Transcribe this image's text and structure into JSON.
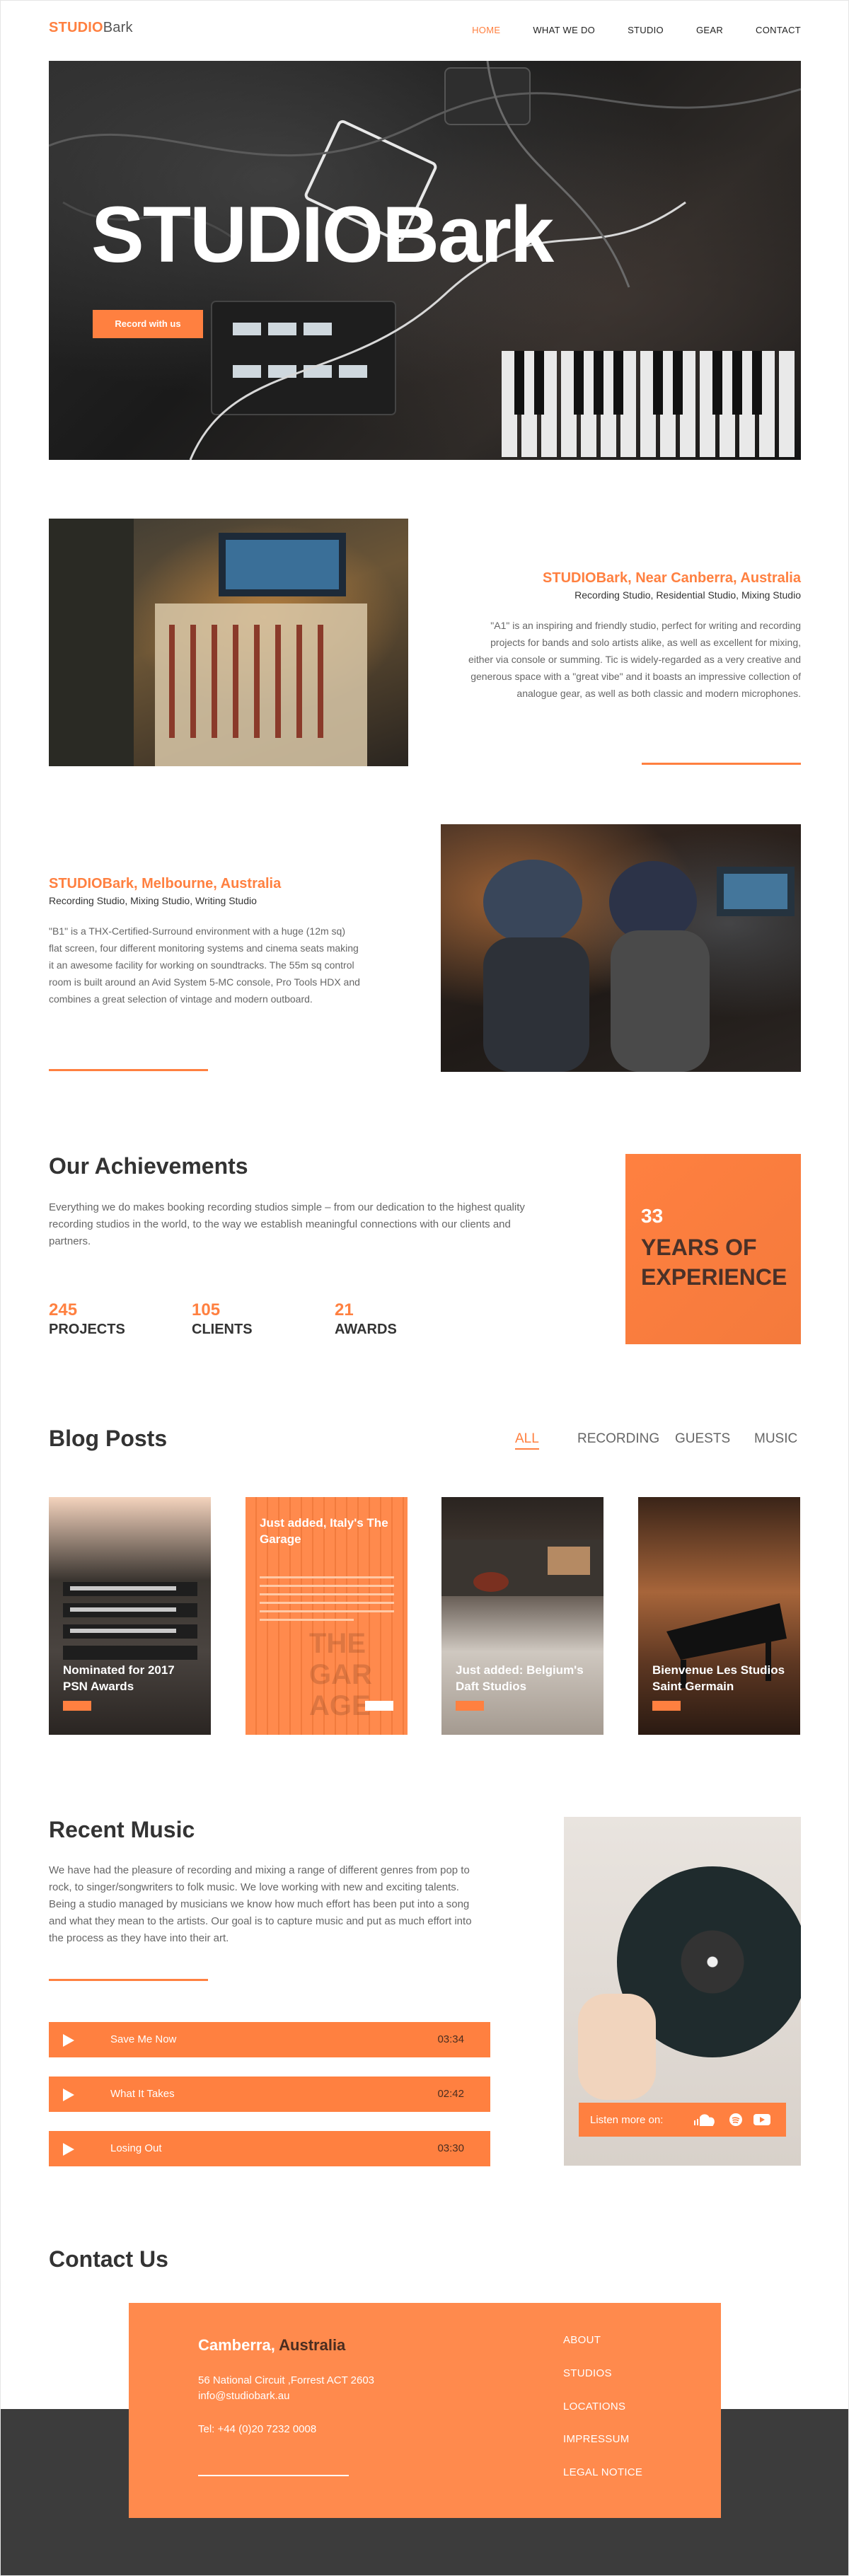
{
  "header": {
    "logo_part1": "STUDIO",
    "logo_part2": "Bark",
    "nav": [
      "HOME",
      "WHAT WE DO",
      "STUDIO",
      "GEAR",
      "CONTACT"
    ]
  },
  "hero": {
    "title": "STUDIOBark",
    "cta": "Record with us"
  },
  "studios": [
    {
      "title": "STUDIOBark, Near Canberra, Australia",
      "subtitle": "Recording Studio, Residential Studio, Mixing Studio",
      "text": "\"A1\" is an inspiring and friendly studio, perfect for writing and recording projects for bands and solo artists alike, as well as excellent for mixing, either via console or summing. Tic is widely-regarded as a very creative and generous space with a \"great vibe\" and it boasts an impressive collection of analogue gear, as well as both classic and modern microphones."
    },
    {
      "title": "STUDIOBark, Melbourne, Australia",
      "subtitle": "Recording Studio, Mixing Studio, Writing Studio",
      "text": "\"B1\" is a THX-Certified-Surround environment with a huge (12m sq) flat screen, four different monitoring systems and cinema seats making it an awesome facility for working on soundtracks. The 55m sq control room is built around an Avid System 5-MC console, Pro Tools HDX and combines a great selection of vintage and modern outboard."
    }
  ],
  "achievements": {
    "heading": "Our Achievements",
    "text": "Everything we do makes booking recording studios simple – from our dedication to the highest quality recording studios in the world, to the way we establish meaningful connections with our clients and partners.",
    "stats": [
      {
        "num": "245",
        "label": "PROJECTS"
      },
      {
        "num": "105",
        "label": "CLIENTS"
      },
      {
        "num": "21",
        "label": "AWARDS"
      }
    ],
    "experience": {
      "num": "33",
      "line1": "YEARS OF",
      "line2": "EXPERIENCE"
    }
  },
  "blog": {
    "heading": "Blog Posts",
    "filters": [
      "ALL",
      "RECORDING",
      "GUESTS",
      "MUSIC"
    ],
    "cards": [
      {
        "title": "Nominated for 2017 PSN Awards"
      },
      {
        "title": "Just added, Italy's The Garage",
        "background_text": "THE GAR AGE"
      },
      {
        "title": "Just added: Belgium's Daft Studios"
      },
      {
        "title": "Bienvenue Les Studios Saint Germain"
      }
    ]
  },
  "music": {
    "heading": "Recent Music",
    "text": "We have had the pleasure of recording and mixing a range of different genres from pop to rock, to singer/songwriters to folk music. We love working with new and exciting talents. Being a studio managed by musicians we know how much effort has been put into a song and what they mean to the artists. Our goal is to capture music and put as much effort into the process as they have into their art.",
    "tracks": [
      {
        "name": "Save Me Now",
        "time": "03:34"
      },
      {
        "name": "What It Takes",
        "time": "02:42"
      },
      {
        "name": "Losing Out",
        "time": "03:30"
      }
    ],
    "listen_label": "Listen more on:",
    "icons": [
      "soundcloud-icon",
      "spotify-icon",
      "youtube-icon"
    ]
  },
  "contact": {
    "heading": "Contact Us",
    "city": "Camberra,",
    "country": "Australia",
    "address": "56 National Circuit ,Forrest ACT 2603",
    "email": "info@studiobark.au",
    "phone": "Tel: +44 (0)20 7232 0008",
    "links": [
      "ABOUT",
      "STUDIOS",
      "LOCATIONS",
      "IMPRESSUM",
      "LEGAL NOTICE"
    ]
  },
  "colors": {
    "accent": "#ff8040",
    "dark": "#3c3c3c"
  }
}
